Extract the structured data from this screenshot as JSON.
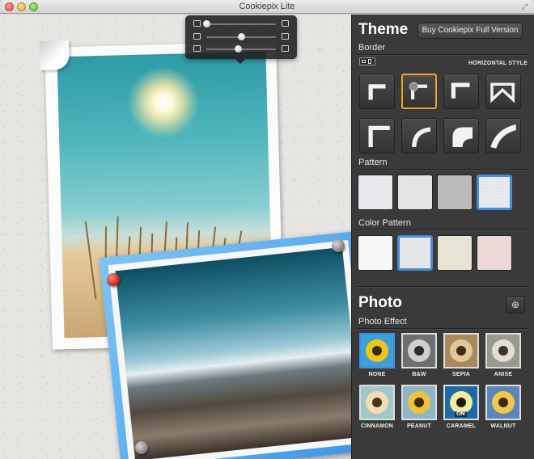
{
  "window": {
    "title": "Cookiepix Lite"
  },
  "adjustments": {
    "sliders": [
      {
        "name": "size",
        "level": 0.0
      },
      {
        "name": "border",
        "level": 0.5
      },
      {
        "name": "shadow",
        "level": 0.45
      }
    ]
  },
  "sidebar": {
    "theme_title": "Theme",
    "buy_button": "Buy Cookiepix Full Version",
    "border_label": "Border",
    "horizontal_style": "HORIZONTAL STYLE",
    "pattern_label": "Pattern",
    "color_pattern_label": "Color Pattern",
    "photo_title": "Photo",
    "photo_effect_label": "Photo Effect",
    "border_styles": [
      {
        "name": "border-style-1",
        "selected": false
      },
      {
        "name": "border-style-2-pin",
        "selected": true
      },
      {
        "name": "border-style-3",
        "selected": false
      },
      {
        "name": "border-style-4",
        "selected": false
      },
      {
        "name": "border-style-5",
        "selected": false
      },
      {
        "name": "border-style-6",
        "selected": false
      },
      {
        "name": "border-style-7",
        "selected": false
      },
      {
        "name": "border-style-8",
        "selected": false
      }
    ],
    "patterns": [
      {
        "color": "#e9ebee",
        "selected": false
      },
      {
        "color": "#e6e6e6",
        "selected": false
      },
      {
        "color": "#bdbdbd",
        "selected": false
      },
      {
        "color": "#e8eaed",
        "selected": true
      }
    ],
    "color_patterns": [
      {
        "color": "#f7f7f7",
        "selected": false
      },
      {
        "color": "#e4e6e8",
        "selected": true
      },
      {
        "color": "#e7e3d5",
        "selected": false
      },
      {
        "color": "#ecd8d6",
        "selected": false
      }
    ],
    "effects": [
      {
        "label": "NONE",
        "petal": "#f2c419",
        "center": "#3b2a10",
        "bg": "#3c9fd6",
        "selected": true
      },
      {
        "label": "B&W",
        "petal": "#cfcfcf",
        "center": "#2c2c2c",
        "bg": "#6f6f6f",
        "selected": false
      },
      {
        "label": "SEPIA",
        "petal": "#e2c79b",
        "center": "#3e2e1a",
        "bg": "#a88a5e",
        "selected": false
      },
      {
        "label": "ANISE",
        "petal": "#e3ddd2",
        "center": "#3a342e",
        "bg": "#9a9892",
        "selected": false
      },
      {
        "label": "CINNAMON",
        "petal": "#f3dcb4",
        "center": "#4a3218",
        "bg": "#a2c7c9",
        "selected": false
      },
      {
        "label": "PEANUT",
        "petal": "#f0c23c",
        "center": "#3b2a10",
        "bg": "#8fb6c7",
        "selected": false
      },
      {
        "label": "CARAMEL",
        "petal": "#f6e9a0",
        "center": "#1e1a12",
        "bg": "#1d6aa5",
        "selected": false,
        "badge": "ON"
      },
      {
        "label": "WALNUT",
        "petal": "#f0c74a",
        "center": "#3b2a10",
        "bg": "#5c86b8",
        "selected": false
      }
    ]
  }
}
